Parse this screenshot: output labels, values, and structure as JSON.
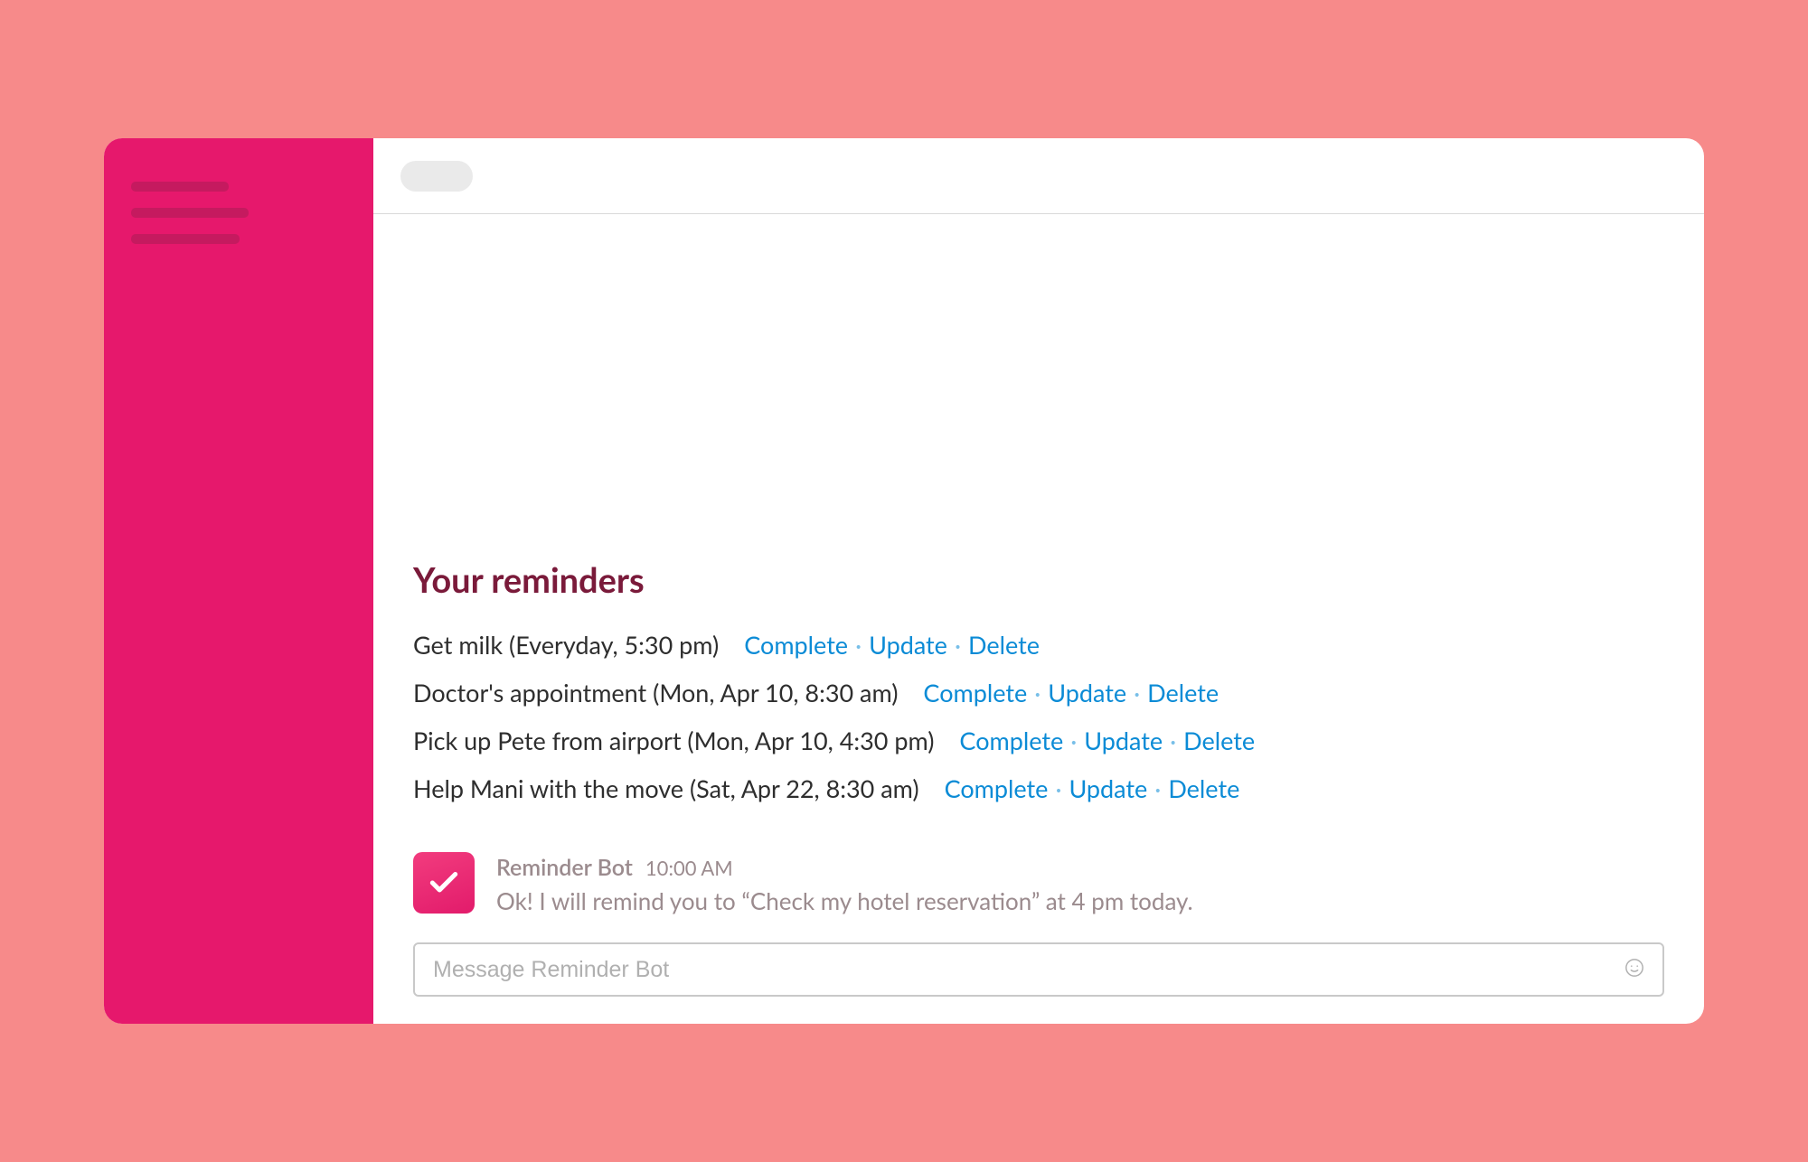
{
  "title": "Your reminders",
  "reminders": [
    {
      "text": "Get milk (Everyday, 5:30 pm)"
    },
    {
      "text": "Doctor's appointment (Mon, Apr 10, 8:30 am)"
    },
    {
      "text": "Pick up Pete from airport (Mon, Apr 10, 4:30 pm)"
    },
    {
      "text": "Help Mani with the move (Sat, Apr 22, 8:30 am)"
    }
  ],
  "actions": {
    "complete": "Complete",
    "update": "Update",
    "delete": "Delete",
    "sep": "·"
  },
  "bot": {
    "name": "Reminder Bot",
    "time": "10:00 AM",
    "message": "Ok! I will remind you to “Check my hotel reservation” at 4 pm today."
  },
  "input": {
    "placeholder": "Message Reminder Bot"
  }
}
